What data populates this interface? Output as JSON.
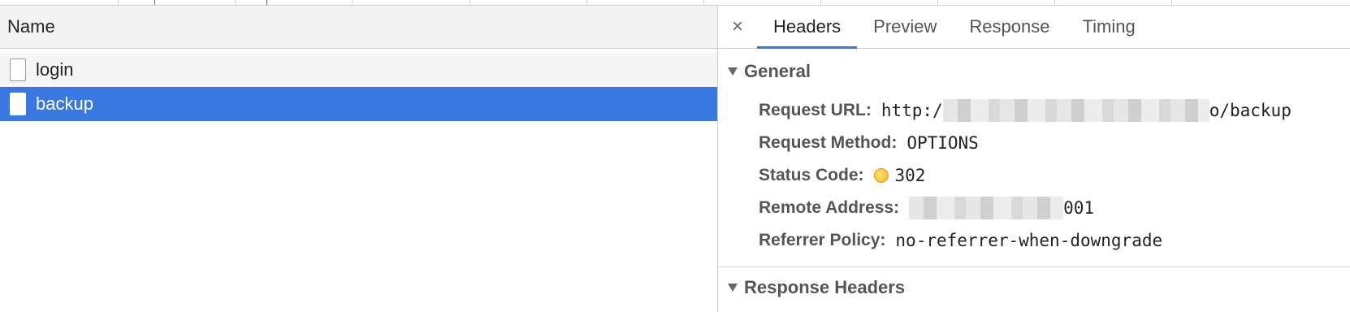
{
  "left_panel": {
    "column_header": "Name",
    "requests": [
      {
        "name": "login",
        "selected": false
      },
      {
        "name": "backup",
        "selected": true
      }
    ]
  },
  "right_panel": {
    "close_icon": "×",
    "tabs": [
      {
        "label": "Headers",
        "active": true
      },
      {
        "label": "Preview",
        "active": false
      },
      {
        "label": "Response",
        "active": false
      },
      {
        "label": "Timing",
        "active": false
      }
    ],
    "general": {
      "title": "General",
      "request_url_label": "Request URL:",
      "request_url_prefix": "http:/",
      "request_url_suffix": "o/backup",
      "request_method_label": "Request Method:",
      "request_method_value": "OPTIONS",
      "status_code_label": "Status Code:",
      "status_code_value": "302",
      "status_color": "#f2b21c",
      "remote_address_label": "Remote Address:",
      "remote_address_suffix": "001",
      "referrer_policy_label": "Referrer Policy:",
      "referrer_policy_value": "no-referrer-when-downgrade"
    },
    "response_headers": {
      "title": "Response Headers"
    }
  },
  "colors": {
    "selected_row": "#3878e0",
    "active_tab_underline": "#3a76d6"
  }
}
